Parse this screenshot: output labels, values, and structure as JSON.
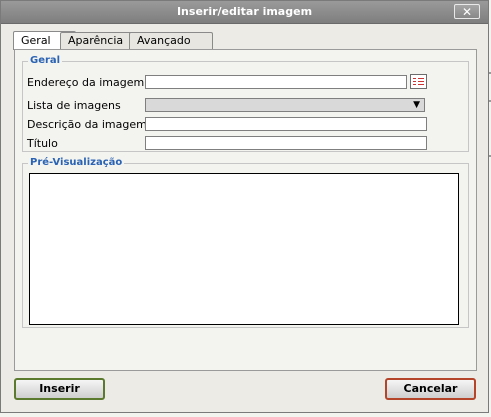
{
  "window": {
    "title": "Inserir/editar imagem",
    "close_symbol": "✕"
  },
  "tabs": [
    {
      "label": "Geral",
      "active": true
    },
    {
      "label": "Aparência",
      "active": false
    },
    {
      "label": "Avançado",
      "active": false
    }
  ],
  "general_section": {
    "legend": "Geral",
    "fields": {
      "image_url": {
        "label": "Endereço da imagem",
        "value": ""
      },
      "image_list": {
        "label": "Lista de imagens",
        "selected": ""
      },
      "image_description": {
        "label": "Descrição da imagem",
        "value": ""
      },
      "title": {
        "label": "Título",
        "value": ""
      }
    }
  },
  "preview_section": {
    "legend": "Pré-Visualização"
  },
  "buttons": {
    "insert": "Inserir",
    "cancel": "Cancelar"
  },
  "colors": {
    "legend_blue": "#2a63b3",
    "insert_border": "#5c7a2e",
    "cancel_border": "#b4442a",
    "titlebar": "#8a8a8a"
  },
  "icons": {
    "browse": "browse-list-icon",
    "dropdown": "chevron-down-icon",
    "close": "close-icon"
  }
}
